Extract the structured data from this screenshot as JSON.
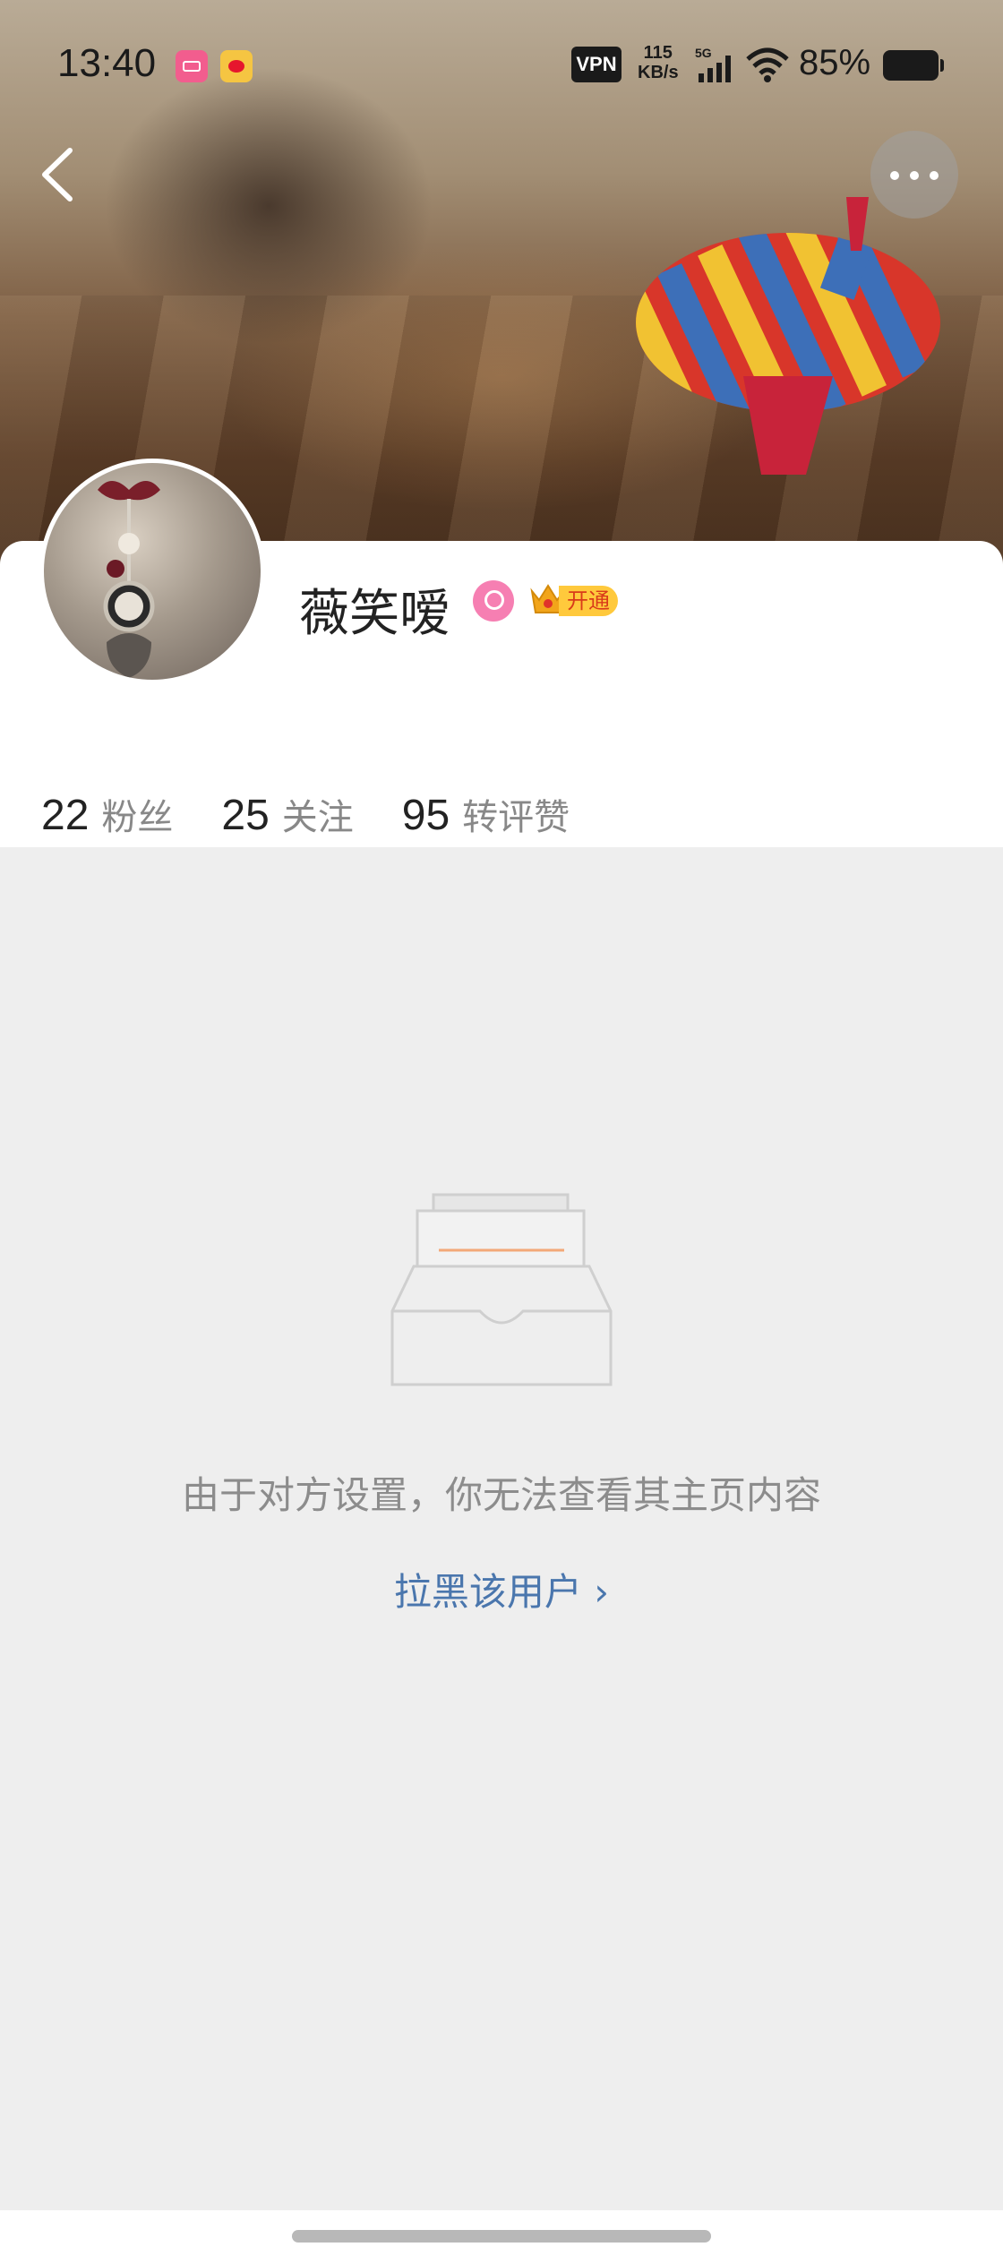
{
  "status_bar": {
    "time": "13:40",
    "vpn": "VPN",
    "speed_value": "115",
    "speed_unit": "KB/s",
    "network": "5G",
    "battery": "85%",
    "icons": [
      "bilibili-icon",
      "weibo-icon",
      "signal-icon",
      "wifi-icon",
      "battery-icon"
    ]
  },
  "header": {
    "back_icon": "chevron-left-icon",
    "more_icon": "more-dots-icon"
  },
  "profile": {
    "username": "薇笑嗳",
    "gender_icon": "female-icon",
    "vip_label": "开通",
    "vip_icon": "crown-icon"
  },
  "stats": [
    {
      "value": "22",
      "label": "粉丝"
    },
    {
      "value": "25",
      "label": "关注"
    },
    {
      "value": "95",
      "label": "转评赞"
    }
  ],
  "empty_state": {
    "icon": "inbox-tray-icon",
    "message": "由于对方设置，你无法查看其主页内容",
    "action": "拉黑该用户 ›"
  },
  "colors": {
    "page_bg": "#eeeeee",
    "link": "#4a76ad",
    "vip": "#ffc93c",
    "gender": "#f67fb2"
  }
}
